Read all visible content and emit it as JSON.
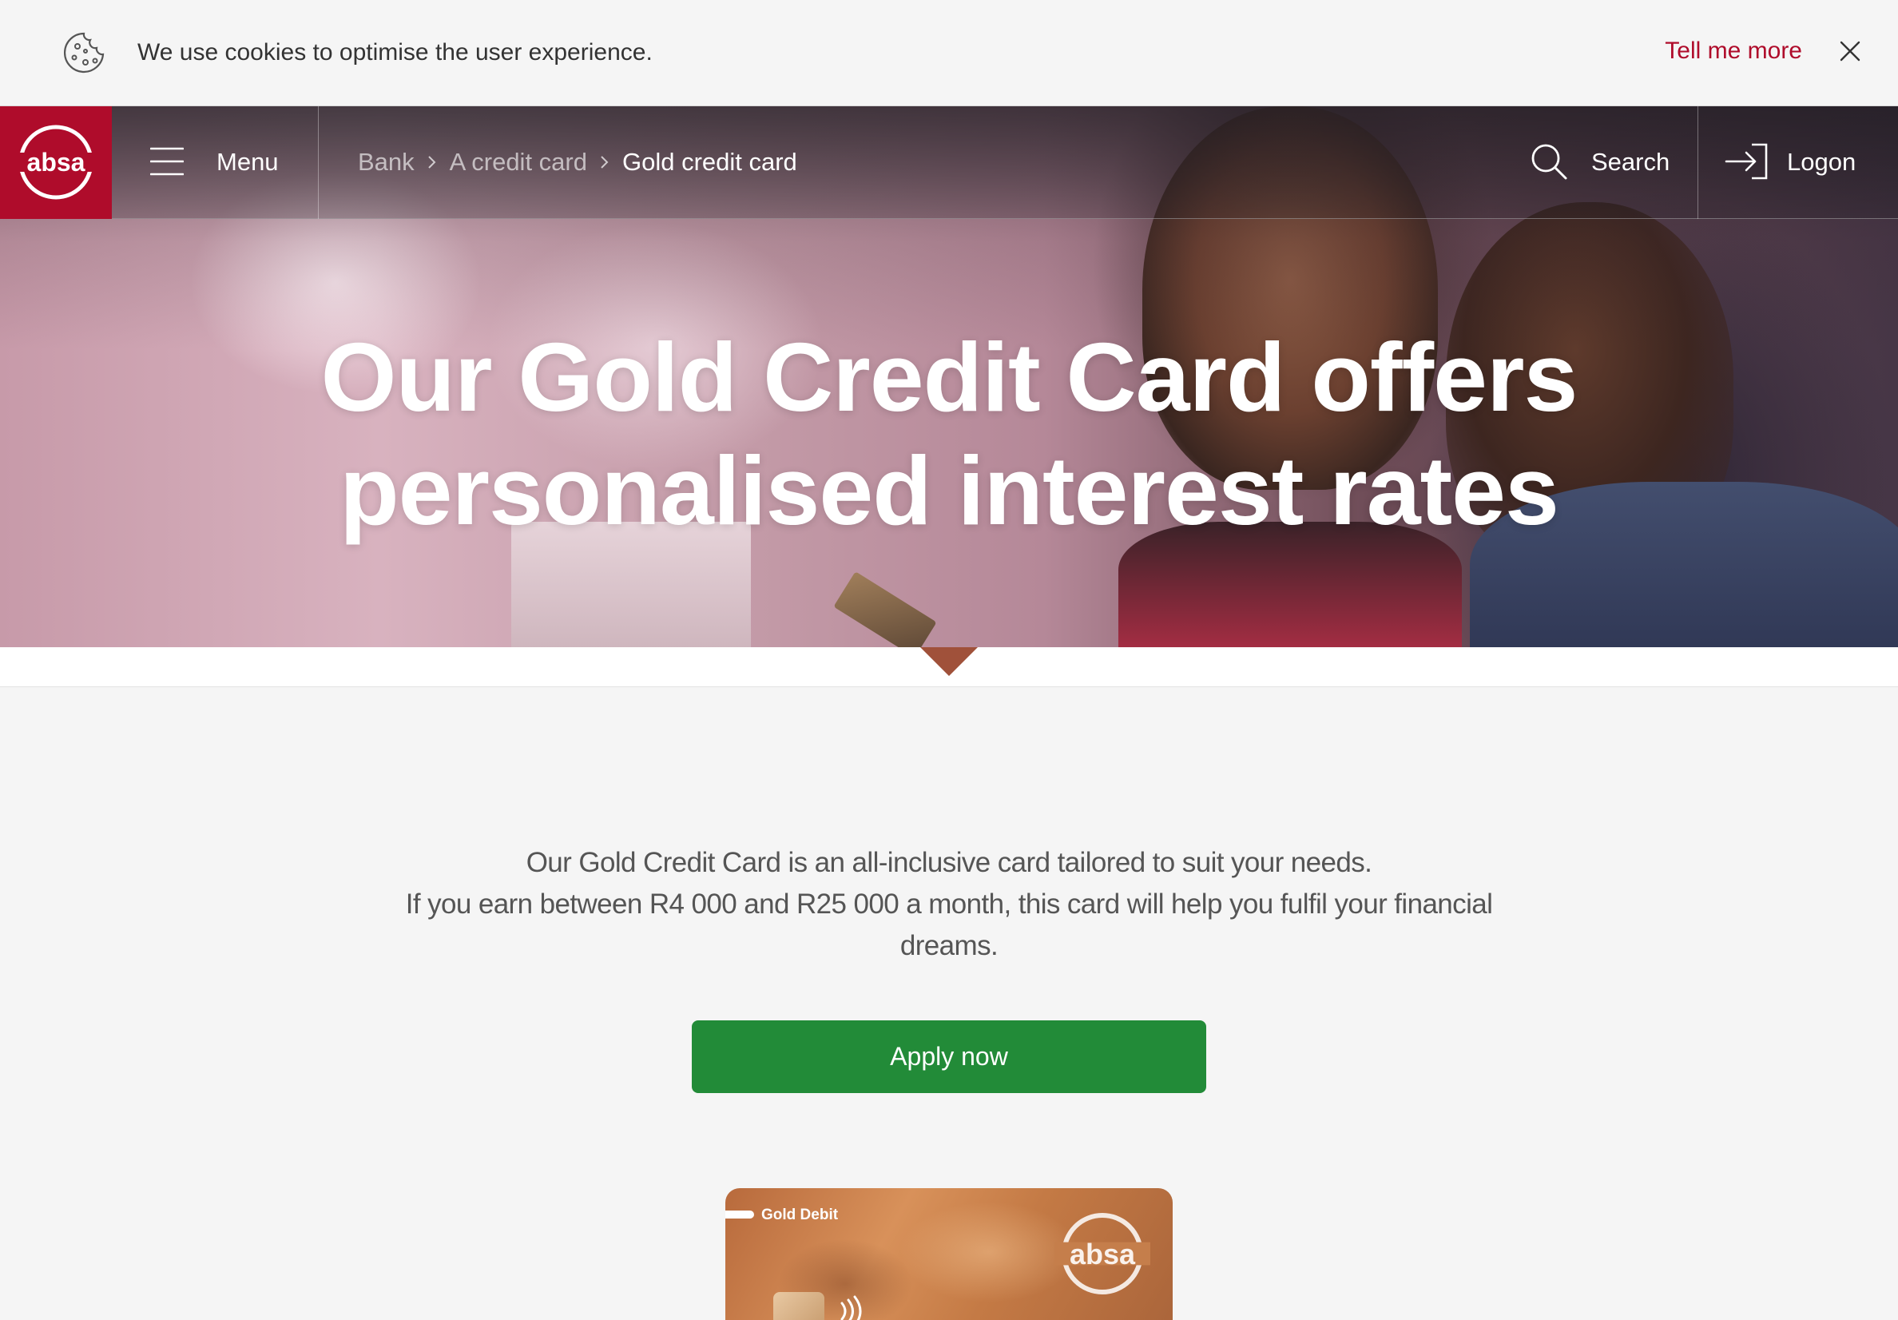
{
  "cookie_banner": {
    "message": "We use cookies to optimise the user experience.",
    "more_link": "Tell me more",
    "icons": {
      "cookie": "cookie-icon",
      "close": "close-icon"
    }
  },
  "nav": {
    "logo_text": "absa",
    "menu_label": "Menu",
    "breadcrumb": [
      "Bank",
      "A credit card",
      "Gold credit card"
    ],
    "search_label": "Search",
    "logon_label": "Logon",
    "icons": {
      "menu": "hamburger-icon",
      "crumb_sep": "chevron-right-icon",
      "search": "search-icon",
      "logon": "logon-arrow-icon"
    }
  },
  "hero": {
    "title_line1": "Our Gold Credit Card offers",
    "title_line2": "personalised interest rates"
  },
  "intro": {
    "line1": "Our Gold Credit Card is an all-inclusive card tailored to suit your needs.",
    "line2": "If you earn between R4 000 and R25 000 a month, this card will help you fulfil your financial",
    "line3": "dreams."
  },
  "cta": {
    "apply_label": "Apply now"
  },
  "card_image": {
    "tag": "Gold Debit",
    "logo_text": "absa"
  },
  "colors": {
    "brand_red": "#af0c2b",
    "cta_green": "#228b38",
    "page_background": "#f5f5f5",
    "body_text": "#555555"
  }
}
